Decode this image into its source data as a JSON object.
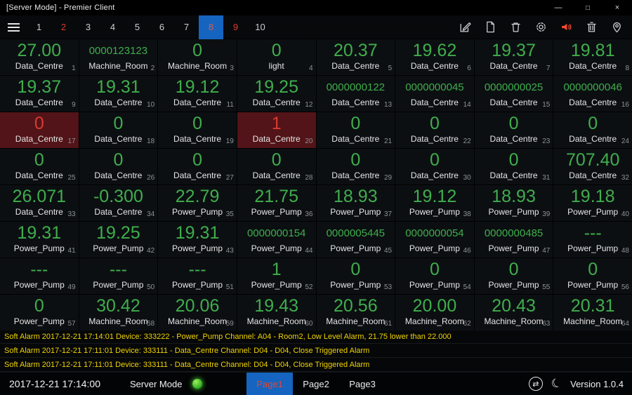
{
  "window": {
    "title": "[Server Mode] - Premier Client",
    "minimize": "—",
    "maximize": "□",
    "close": "×"
  },
  "toolbar": {
    "tabs": [
      {
        "label": "1",
        "state": "normal"
      },
      {
        "label": "2",
        "state": "alert"
      },
      {
        "label": "3",
        "state": "normal"
      },
      {
        "label": "4",
        "state": "normal"
      },
      {
        "label": "5",
        "state": "normal"
      },
      {
        "label": "6",
        "state": "normal"
      },
      {
        "label": "7",
        "state": "normal"
      },
      {
        "label": "8",
        "state": "selected"
      },
      {
        "label": "9",
        "state": "alert"
      },
      {
        "label": "10",
        "state": "normal"
      }
    ],
    "icons": [
      "edit-icon",
      "document-icon",
      "delete-icon",
      "settings-icon",
      "mute-alarm-icon",
      "clear-alarms-icon",
      "location-icon"
    ]
  },
  "colors": {
    "accent_blue": "#1565c0",
    "value_green": "#3fae4c",
    "alert_red": "#d93a31",
    "alarm_tile_bg": "#521418",
    "alarm_text_yellow": "#f0d400",
    "speaker_orange": "#ff4a2f",
    "status_dot_green": "#2fae22"
  },
  "grid": {
    "tiles": [
      {
        "i": 1,
        "v": "27.00",
        "l": "Data_Centre"
      },
      {
        "i": 2,
        "v": "0000123123",
        "l": "Machine_Room"
      },
      {
        "i": 3,
        "v": "0",
        "l": "Machine_Room"
      },
      {
        "i": 4,
        "v": "0",
        "l": "light"
      },
      {
        "i": 5,
        "v": "20.37",
        "l": "Data_Centre"
      },
      {
        "i": 6,
        "v": "19.62",
        "l": "Data_Centre"
      },
      {
        "i": 7,
        "v": "19.37",
        "l": "Data_Centre"
      },
      {
        "i": 8,
        "v": "19.81",
        "l": "Data_Centre"
      },
      {
        "i": 9,
        "v": "19.37",
        "l": "Data_Centre"
      },
      {
        "i": 10,
        "v": "19.31",
        "l": "Data_Centre"
      },
      {
        "i": 11,
        "v": "19.12",
        "l": "Data_Centre"
      },
      {
        "i": 12,
        "v": "19.25",
        "l": "Data_Centre"
      },
      {
        "i": 13,
        "v": "0000000122",
        "l": "Data_Centre"
      },
      {
        "i": 14,
        "v": "0000000045",
        "l": "Data_Centre"
      },
      {
        "i": 15,
        "v": "0000000025",
        "l": "Data_Centre"
      },
      {
        "i": 16,
        "v": "0000000046",
        "l": "Data_Centre"
      },
      {
        "i": 17,
        "v": "0",
        "l": "Data_Centre",
        "alarm": true
      },
      {
        "i": 18,
        "v": "0",
        "l": "Data_Centre"
      },
      {
        "i": 19,
        "v": "0",
        "l": "Data_Centre"
      },
      {
        "i": 20,
        "v": "1",
        "l": "Data_Centre",
        "alarm": true
      },
      {
        "i": 21,
        "v": "0",
        "l": "Data_Centre"
      },
      {
        "i": 22,
        "v": "0",
        "l": "Data_Centre"
      },
      {
        "i": 23,
        "v": "0",
        "l": "Data_Centre"
      },
      {
        "i": 24,
        "v": "0",
        "l": "Data_Centre"
      },
      {
        "i": 25,
        "v": "0",
        "l": "Data_Centre"
      },
      {
        "i": 26,
        "v": "0",
        "l": "Data_Centre"
      },
      {
        "i": 27,
        "v": "0",
        "l": "Data_Centre"
      },
      {
        "i": 28,
        "v": "0",
        "l": "Data_Centre"
      },
      {
        "i": 29,
        "v": "0",
        "l": "Data_Centre"
      },
      {
        "i": 30,
        "v": "0",
        "l": "Data_Centre"
      },
      {
        "i": 31,
        "v": "0",
        "l": "Data_Centre"
      },
      {
        "i": 32,
        "v": "707.40",
        "l": "Data_Centre"
      },
      {
        "i": 33,
        "v": "26.071",
        "l": "Data_Centre"
      },
      {
        "i": 34,
        "v": "-0.300",
        "l": "Data_Centre"
      },
      {
        "i": 35,
        "v": "22.79",
        "l": "Power_Pump"
      },
      {
        "i": 36,
        "v": "21.75",
        "l": "Power_Pump"
      },
      {
        "i": 37,
        "v": "18.93",
        "l": "Power_Pump"
      },
      {
        "i": 38,
        "v": "19.12",
        "l": "Power_Pump"
      },
      {
        "i": 39,
        "v": "18.93",
        "l": "Power_Pump"
      },
      {
        "i": 40,
        "v": "19.18",
        "l": "Power_Pump"
      },
      {
        "i": 41,
        "v": "19.31",
        "l": "Power_Pump"
      },
      {
        "i": 42,
        "v": "19.25",
        "l": "Power_Pump"
      },
      {
        "i": 43,
        "v": "19.31",
        "l": "Power_Pump"
      },
      {
        "i": 44,
        "v": "0000000154",
        "l": "Power_Pump"
      },
      {
        "i": 45,
        "v": "0000005445",
        "l": "Power_Pump"
      },
      {
        "i": 46,
        "v": "0000000054",
        "l": "Power_Pump"
      },
      {
        "i": 47,
        "v": "0000000485",
        "l": "Power_Pump"
      },
      {
        "i": 48,
        "v": "---",
        "l": "Power_Pump"
      },
      {
        "i": 49,
        "v": "---",
        "l": "Power_Pump"
      },
      {
        "i": 50,
        "v": "---",
        "l": "Power_Pump"
      },
      {
        "i": 51,
        "v": "---",
        "l": "Power_Pump"
      },
      {
        "i": 52,
        "v": "1",
        "l": "Power_Pump"
      },
      {
        "i": 53,
        "v": "0",
        "l": "Power_Pump"
      },
      {
        "i": 54,
        "v": "0",
        "l": "Power_Pump"
      },
      {
        "i": 55,
        "v": "0",
        "l": "Power_Pump"
      },
      {
        "i": 56,
        "v": "0",
        "l": "Power_Pump"
      },
      {
        "i": 57,
        "v": "0",
        "l": "Power_Pump"
      },
      {
        "i": 58,
        "v": "30.42",
        "l": "Machine_Room"
      },
      {
        "i": 59,
        "v": "20.06",
        "l": "Machine_Room"
      },
      {
        "i": 60,
        "v": "19.43",
        "l": "Machine_Room"
      },
      {
        "i": 61,
        "v": "20.56",
        "l": "Machine_Room"
      },
      {
        "i": 62,
        "v": "20.00",
        "l": "Machine_Room"
      },
      {
        "i": 63,
        "v": "20.43",
        "l": "Machine_Room"
      },
      {
        "i": 64,
        "v": "20.31",
        "l": "Machine_Room"
      }
    ]
  },
  "alarms": [
    "Soft Alarm 2017-12-21 17:14:01 Device: 333222 - Power_Pump Channel: A04 - Room2, Low Level Alarm, 21.75 lower than 22.000",
    "Soft Alarm 2017-12-21 17:11:01 Device: 333111 - Data_Centre Channel: D04 - D04, Close Triggered Alarm",
    "Soft Alarm 2017-12-21 17:11:01 Device: 333111 - Data_Centre Channel: D04 - D04, Close Triggered Alarm"
  ],
  "statusbar": {
    "timestamp": "2017-12-21 17:14:00",
    "mode_label": "Server Mode",
    "pages": [
      {
        "label": "Page1",
        "selected": true
      },
      {
        "label": "Page2",
        "selected": false
      },
      {
        "label": "Page3",
        "selected": false
      }
    ],
    "version": "Version 1.0.4"
  }
}
